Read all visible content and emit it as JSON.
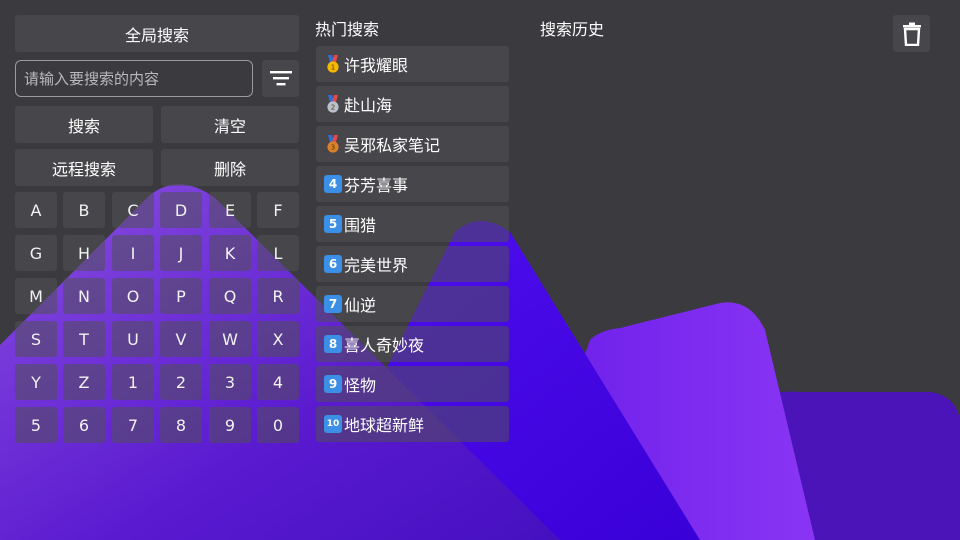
{
  "left": {
    "global_search_label": "全局搜索",
    "search_placeholder": "请输入要搜索的内容",
    "search_label": "搜索",
    "clear_label": "清空",
    "remote_search_label": "远程搜索",
    "delete_label": "删除",
    "keyboard_rows": [
      [
        "A",
        "B",
        "C",
        "D",
        "E",
        "F"
      ],
      [
        "G",
        "H",
        "I",
        "J",
        "K",
        "L"
      ],
      [
        "M",
        "N",
        "O",
        "P",
        "Q",
        "R"
      ],
      [
        "S",
        "T",
        "U",
        "V",
        "W",
        "X"
      ],
      [
        "Y",
        "Z",
        "1",
        "2",
        "3",
        "4"
      ],
      [
        "5",
        "6",
        "7",
        "8",
        "9",
        "0"
      ]
    ]
  },
  "hot": {
    "title": "热门搜索",
    "items": [
      {
        "rank_icon": "gold-medal-icon",
        "rank": "1",
        "label": "许我耀眼"
      },
      {
        "rank_icon": "silver-medal-icon",
        "rank": "2",
        "label": "赴山海"
      },
      {
        "rank_icon": "bronze-medal-icon",
        "rank": "3",
        "label": "吴邪私家笔记"
      },
      {
        "rank_icon": "keycap-4-icon",
        "rank": "4",
        "label": "芬芳喜事"
      },
      {
        "rank_icon": "keycap-5-icon",
        "rank": "5",
        "label": "围猎"
      },
      {
        "rank_icon": "keycap-6-icon",
        "rank": "6",
        "label": "完美世界"
      },
      {
        "rank_icon": "keycap-7-icon",
        "rank": "7",
        "label": "仙逆"
      },
      {
        "rank_icon": "keycap-8-icon",
        "rank": "8",
        "label": "喜人奇妙夜"
      },
      {
        "rank_icon": "keycap-9-icon",
        "rank": "9",
        "label": "怪物"
      },
      {
        "rank_icon": "keycap-10-icon",
        "rank": "10",
        "label": "地球超新鲜"
      }
    ]
  },
  "history": {
    "title": "搜索历史",
    "clear_icon": "trash-icon"
  },
  "colors": {
    "background": "#3a3a3f",
    "accent_purple": "#5a1fd8",
    "accent_violet": "#7b2cf0",
    "numbox_blue": "#3b8fe6"
  }
}
